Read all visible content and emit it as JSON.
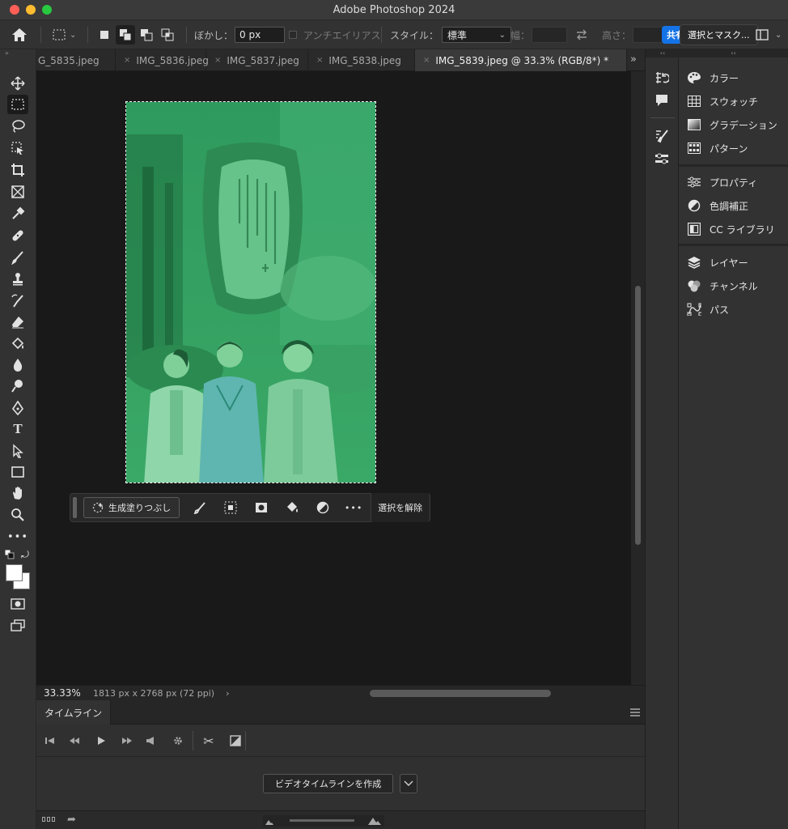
{
  "window": {
    "title": "Adobe Photoshop 2024"
  },
  "options_bar": {
    "feather_label": "ぼかし：",
    "feather_value": "0 px",
    "antialias_label": "アンチエイリアス",
    "style_label": "スタイル：",
    "style_value": "標準",
    "width_label": "幅：",
    "width_value": "",
    "height_label": "高さ：",
    "height_value": "",
    "share_label": "共有",
    "select_mask_label": "選択とマスク..."
  },
  "tabs": [
    {
      "label": "G_5835.jpeg",
      "active": false
    },
    {
      "label": "IMG_5836.jpeg",
      "active": false
    },
    {
      "label": "IMG_5837.jpeg",
      "active": false
    },
    {
      "label": "IMG_5838.jpeg",
      "active": false
    },
    {
      "label": "IMG_5839.jpeg @ 33.3% (RGB/8*) *",
      "active": true
    }
  ],
  "tabs_overflow": "»",
  "context_bar": {
    "generative_fill": "生成塗りつぶし",
    "deselect": "選択を解除",
    "more": "•••"
  },
  "status": {
    "zoom": "33.33%",
    "doc_info": "1813 px x 2768 px (72 ppi)",
    "arrow": "›"
  },
  "timeline": {
    "tab_label": "タイムライン",
    "create_button": "ビデオタイムラインを作成"
  },
  "panels": {
    "color": "カラー",
    "swatches": "スウォッチ",
    "gradients": "グラデーション",
    "patterns": "パターン",
    "properties": "プロパティ",
    "adjustments": "色調補正",
    "libraries": "CC ライブラリ",
    "layers": "レイヤー",
    "channels": "チャンネル",
    "paths": "パス"
  },
  "colors": {
    "accent": "#1473e6",
    "photo_tint": "#3fae6a"
  }
}
